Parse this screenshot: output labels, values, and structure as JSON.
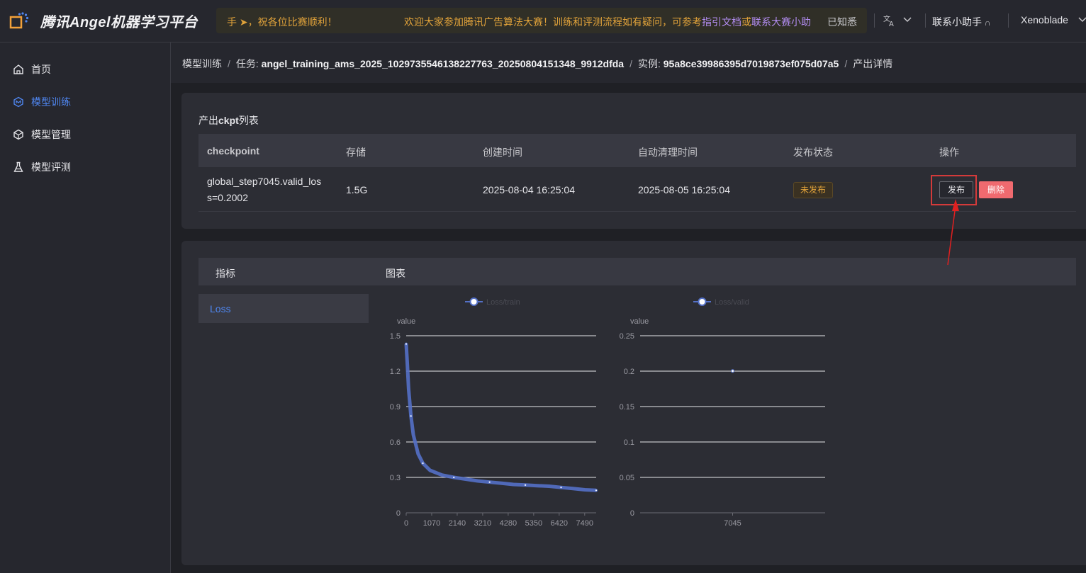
{
  "header": {
    "app_title": "腾讯Angel机器学习平台",
    "notice_part1": "手 ➤，祝各位比赛顺利！",
    "notice_part2": "欢迎大家参加腾讯广告算法大赛！训练和评测流程如有疑问，可参考",
    "notice_link1": "指引文档",
    "notice_or": "或",
    "notice_link2": "联系大赛小助",
    "dismiss_label": "已知悉",
    "helper_label": "联系小助手",
    "user_name": "Xenoblade"
  },
  "sidebar": {
    "items": [
      {
        "label": "首页",
        "icon": "home-icon"
      },
      {
        "label": "模型训练",
        "icon": "training-icon",
        "active": true
      },
      {
        "label": "模型管理",
        "icon": "cube-icon"
      },
      {
        "label": "模型评测",
        "icon": "flask-icon"
      }
    ]
  },
  "breadcrumb": {
    "root": "模型训练",
    "task_prefix": "任务:",
    "task_id": "angel_training_ams_2025_1029735546138227763_20250804151348_9912dfda",
    "instance_prefix": "实例:",
    "instance_id": "95a8ce39986395d7019873ef075d07a5",
    "current": "产出详情"
  },
  "ckpt_table": {
    "title_prefix": "产出",
    "title_bold": "ckpt",
    "title_suffix": "列表",
    "columns": [
      "checkpoint",
      "存储",
      "创建时间",
      "自动清理时间",
      "发布状态",
      "操作"
    ],
    "rows": [
      {
        "checkpoint_line1": "global_step7045.valid_los",
        "checkpoint_line2": "s=0.2002",
        "storage": "1.5G",
        "created": "2025-08-04 16:25:04",
        "cleanup": "2025-08-05 16:25:04",
        "status": "未发布",
        "publish_label": "发布",
        "delete_label": "删除"
      }
    ]
  },
  "metrics": {
    "col_metric": "指标",
    "col_chart": "图表",
    "items": [
      "Loss"
    ]
  },
  "colors": {
    "accent": "#4f86f0",
    "series": "#5470c6",
    "warning": "#e0a23a",
    "danger": "#f06a6f",
    "highlight": "#d43a3a"
  },
  "chart_data": [
    {
      "type": "line",
      "legend": "Loss/train",
      "ylabel": "value",
      "yticks": [
        "0",
        "0.3",
        "0.6",
        "0.9",
        "1.2",
        "1.5"
      ],
      "ylim": [
        0,
        1.5
      ],
      "xticks": [
        "0",
        "1070",
        "2140",
        "3210",
        "4280",
        "5350",
        "6420",
        "7490"
      ],
      "xlim": [
        0,
        7972
      ],
      "x": [
        0,
        50,
        100,
        200,
        300,
        500,
        700,
        1000,
        1500,
        2000,
        2500,
        3000,
        3500,
        4000,
        4500,
        5000,
        5500,
        6000,
        6500,
        7000,
        7500,
        7972
      ],
      "y": [
        1.43,
        1.25,
        1.05,
        0.82,
        0.66,
        0.5,
        0.42,
        0.36,
        0.32,
        0.3,
        0.285,
        0.27,
        0.26,
        0.25,
        0.24,
        0.235,
        0.23,
        0.225,
        0.215,
        0.205,
        0.195,
        0.19
      ]
    },
    {
      "type": "scatter",
      "legend": "Loss/valid",
      "ylabel": "value",
      "yticks": [
        "0",
        "0.05",
        "0.1",
        "0.15",
        "0.2",
        "0.25"
      ],
      "ylim": [
        0,
        0.25
      ],
      "xticks": [
        "7045"
      ],
      "x": [
        7045
      ],
      "y": [
        0.2002
      ]
    }
  ]
}
